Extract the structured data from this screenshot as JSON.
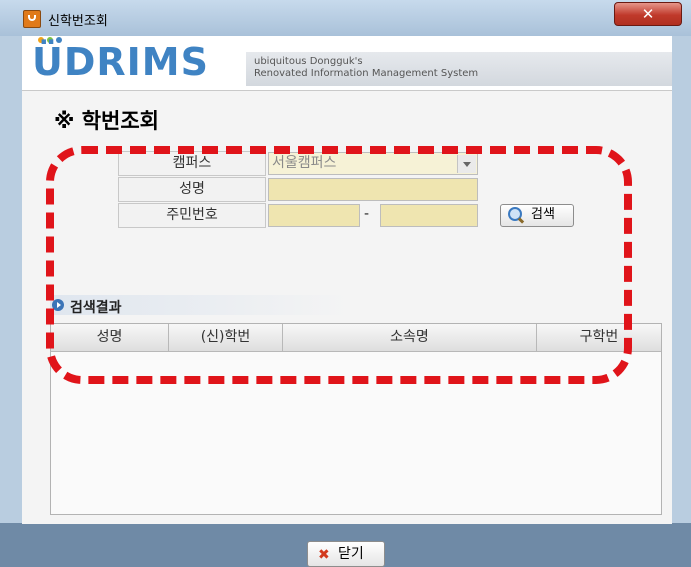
{
  "window": {
    "title": "신학번조회",
    "close_glyph": "✕"
  },
  "branding": {
    "logo": "ÜDRIMS",
    "tagline_line1": "ubiquitous Dongguk's",
    "tagline_line2": "Renovated Information Management System",
    "logo_dot_colors": [
      "#f2a51a",
      "#7cc242",
      "#3f83c3"
    ]
  },
  "page": {
    "title": "※ 학번조회"
  },
  "form": {
    "campus_label": "캠퍼스",
    "campus_value": "서울캠퍼스",
    "name_label": "성명",
    "name_value": "",
    "resident_label": "주민번호",
    "resident_part1": "",
    "resident_separator": "-",
    "resident_part2": "",
    "search_button": "검색"
  },
  "results": {
    "section_title": "검색결과",
    "columns": [
      "성명",
      "(신)학번",
      "소속명",
      "구학번"
    ],
    "rows": []
  },
  "footer": {
    "close_button": "닫기"
  },
  "colors": {
    "accent": "#3f83c3",
    "highlight": "#e0141a",
    "input_fill": "#efe5b0"
  }
}
